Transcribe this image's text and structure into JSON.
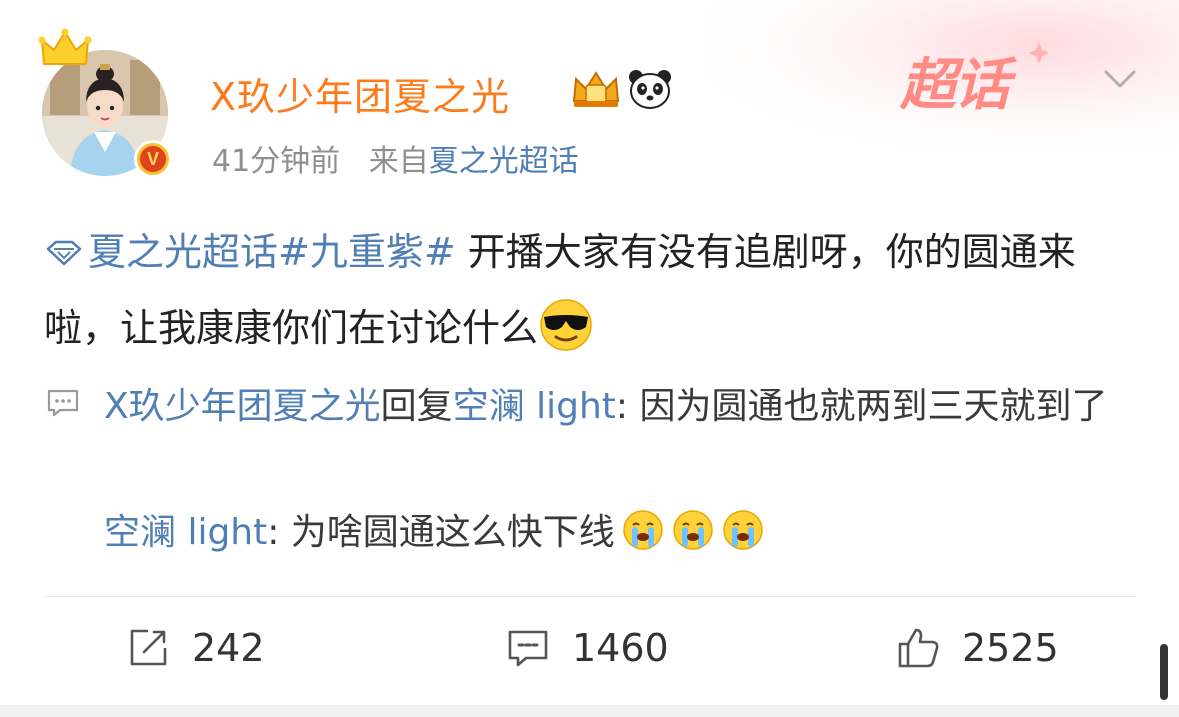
{
  "post": {
    "username": "X玖少年团夏之光",
    "time": "41分钟前",
    "source_prefix": "来自",
    "source": "夏之光超话",
    "super_topic_label": "超话",
    "topic": "夏之光超话",
    "hashtag": "#九重紫#",
    "text": " 开播大家有没有追剧呀，你的圆通来啦，让我康康你们在讨论什么"
  },
  "replies": [
    {
      "author": "X玖少年团夏之光",
      "action": "回复",
      "target": "空澜 light",
      "text": ": 因为圆通也就两到三天就到了"
    },
    {
      "author": "空澜 light",
      "text": ": 为啥圆通这么快下线"
    }
  ],
  "actions": {
    "repost_count": "242",
    "comment_count": "1460",
    "like_count": "2525"
  },
  "colors": {
    "username": "#ff7a1a",
    "link": "#4f7fb4",
    "meta": "#8f8f8f",
    "super_topic": "#ff8b84"
  },
  "icons": [
    "crown-icon",
    "verified-v-icon",
    "vip-crown-badge-icon",
    "panda-icon",
    "super-topic-badge-icon",
    "chevron-down-icon",
    "topic-diamond-icon",
    "sunglasses-emoji-icon",
    "comment-bubble-icon",
    "crying-emoji-icon",
    "repost-icon",
    "comment-icon",
    "like-icon"
  ]
}
